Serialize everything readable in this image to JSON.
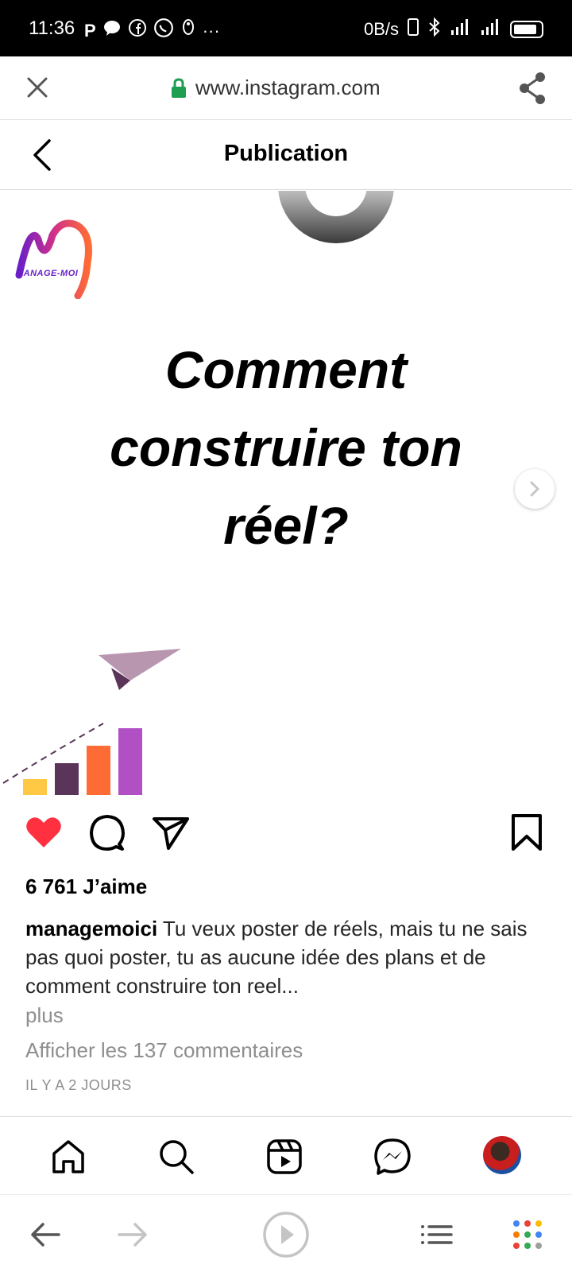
{
  "status_bar": {
    "time": "11:36",
    "network_speed": "0B/s",
    "left_icons": [
      "parking-icon",
      "chat-icon",
      "facebook-icon",
      "whatsapp-icon",
      "notification-icon",
      "more-icon"
    ],
    "right_icons": [
      "sim-icon",
      "bluetooth-icon",
      "signal-icon",
      "signal-icon",
      "battery-icon"
    ]
  },
  "browser": {
    "url": "www.instagram.com",
    "close_icon": "close-icon",
    "lock_icon": "lock-icon",
    "share_icon": "share-icon"
  },
  "header": {
    "title": "Publication",
    "back_icon": "back-arrow-icon"
  },
  "post": {
    "brand_text": "MANAGE-MOI",
    "headline": "Comment construire ton réel?",
    "chart_bar_colors": [
      "#ffc845",
      "#5a3459",
      "#ff6b35",
      "#b14fc5"
    ]
  },
  "actions": {
    "like_icon": "heart-icon",
    "comment_icon": "comment-icon",
    "share_icon": "send-icon",
    "save_icon": "bookmark-icon",
    "like_color": "#ff3040"
  },
  "likes": "6 761 J’aime",
  "caption": {
    "username": "managemoici",
    "text": " Tu veux poster de réels, mais tu ne sais pas quoi poster, tu as aucune idée des plans et de comment construire ton reel..."
  },
  "more_label": "plus",
  "comments_label": "Afficher les 137 commentaires",
  "time_ago": "IL Y A 2 JOURS",
  "bottom_nav": {
    "items": [
      "home-icon",
      "search-icon",
      "reels-icon",
      "messenger-icon",
      "profile-avatar"
    ]
  },
  "browser_nav": {
    "items": [
      "back-icon",
      "forward-icon",
      "play-icon",
      "menu-icon",
      "apps-icon"
    ],
    "apps_dot_colors": [
      "#4285f4",
      "#ea4335",
      "#fbbc05",
      "#f57c00",
      "#34a853",
      "#4285f4",
      "#ea4335",
      "#34a853",
      "#9e9e9e"
    ]
  }
}
